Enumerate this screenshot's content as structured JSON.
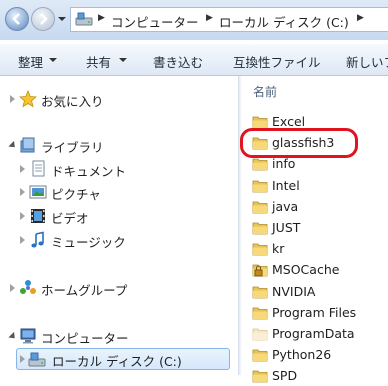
{
  "address": {
    "segments": [
      "コンピューター",
      "ローカル ディスク (C:)"
    ]
  },
  "toolbar": {
    "organize": "整理",
    "share": "共有",
    "burn": "書き込む",
    "compat": "互換性ファイル",
    "newfolder": "新しいフ"
  },
  "nav": {
    "favorites": "お気に入り",
    "libraries": "ライブラリ",
    "documents": "ドキュメント",
    "pictures": "ピクチャ",
    "videos": "ビデオ",
    "music": "ミュージック",
    "homegroup": "ホームグループ",
    "computer": "コンピューター",
    "localdisk": "ローカル ディスク (C:)"
  },
  "content": {
    "column_name": "名前",
    "files": [
      "Excel",
      "glassfish3",
      "info",
      "Intel",
      "java",
      "JUST",
      "kr",
      "MSOCache",
      "NVIDIA",
      "Program Files",
      "ProgramData",
      "Python26",
      "SPD"
    ],
    "highlighted": "glassfish3"
  },
  "colors": {
    "highlight_ring": "#e0141e",
    "selection_border": "#86b5e8"
  }
}
